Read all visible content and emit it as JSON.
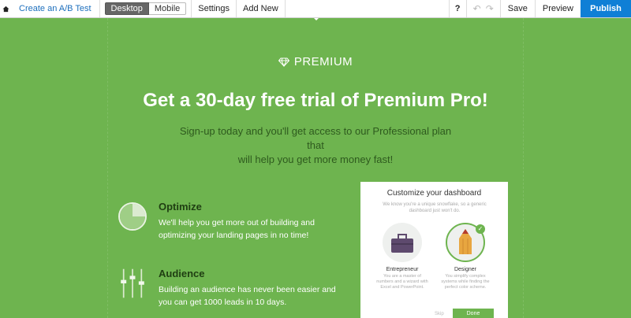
{
  "toolbar": {
    "ab_test": "Create an A/B Test",
    "desktop": "Desktop",
    "mobile": "Mobile",
    "settings": "Settings",
    "add_new": "Add New",
    "help": "?",
    "undo": "↶",
    "redo": "↷",
    "save": "Save",
    "preview": "Preview",
    "publish": "Publish"
  },
  "hero": {
    "badge": "PREMIUM",
    "headline": "Get a 30-day free trial of Premium Pro!",
    "subline_1": "Sign-up today and you'll get access to our Professional plan that",
    "subline_2": "will help you get more money fast!"
  },
  "features": [
    {
      "title": "Optimize",
      "text_1": "We'll help you get more out of building and",
      "text_2": "optimizing your landing pages in no time!"
    },
    {
      "title": "Audience",
      "text_1": "Building an audience has never been easier and",
      "text_2": "you can get 1000 leads in 10 days."
    }
  ],
  "card": {
    "title": "Customize your dashboard",
    "desc": "We know you're a unique snowflake, so a generic dashboard just won't do.",
    "options": [
      {
        "label": "Entrepreneur",
        "desc": "You are a master of numbers and a wizard with Excel and PowerPoint."
      },
      {
        "label": "Designer",
        "desc": "You simplify complex systems while finding the perfect color scheme."
      }
    ],
    "check": "✓",
    "skip": "Skip",
    "done": "Done"
  },
  "colors": {
    "background": "#6eb44f",
    "publish": "#0f7fd6",
    "link": "#1d6fbd",
    "feature_title": "#1f3e12"
  }
}
